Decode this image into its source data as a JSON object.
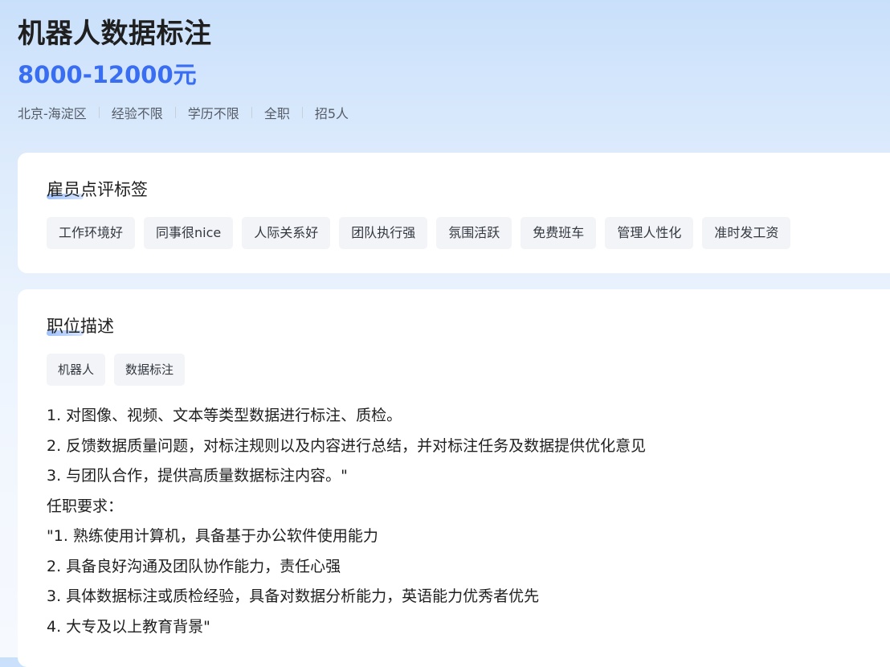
{
  "job": {
    "title": "机器人数据标注",
    "salary": "8000-12000元",
    "meta": [
      "北京-海淀区",
      "经验不限",
      "学历不限",
      "全职",
      "招5人"
    ]
  },
  "employee_tags": {
    "title": "雇员点评标签",
    "tags": [
      "工作环境好",
      "同事很nice",
      "人际关系好",
      "团队执行强",
      "氛围活跃",
      "免费班车",
      "管理人性化",
      "准时发工资"
    ]
  },
  "description": {
    "title": "职位描述",
    "keywords": [
      "机器人",
      "数据标注"
    ],
    "lines": [
      "1. 对图像、视频、文本等类型数据进行标注、质检。",
      "2. 反馈数据质量问题，对标注规则以及内容进行总结，并对标注任务及数据提供优化意见",
      "3. 与团队合作，提供高质量数据标注内容。\"",
      "任职要求：",
      "\"1. 熟练使用计算机，具备基于办公软件使用能力",
      "2. 具备良好沟通及团队协作能力，责任心强",
      "3. 具体数据标注或质检经验，具备对数据分析能力，英语能力优秀者优先",
      "4. 大专及以上教育背景\""
    ]
  },
  "colors": {
    "accent": "#3a6ef2",
    "tag_bg": "#f3f4f7"
  }
}
